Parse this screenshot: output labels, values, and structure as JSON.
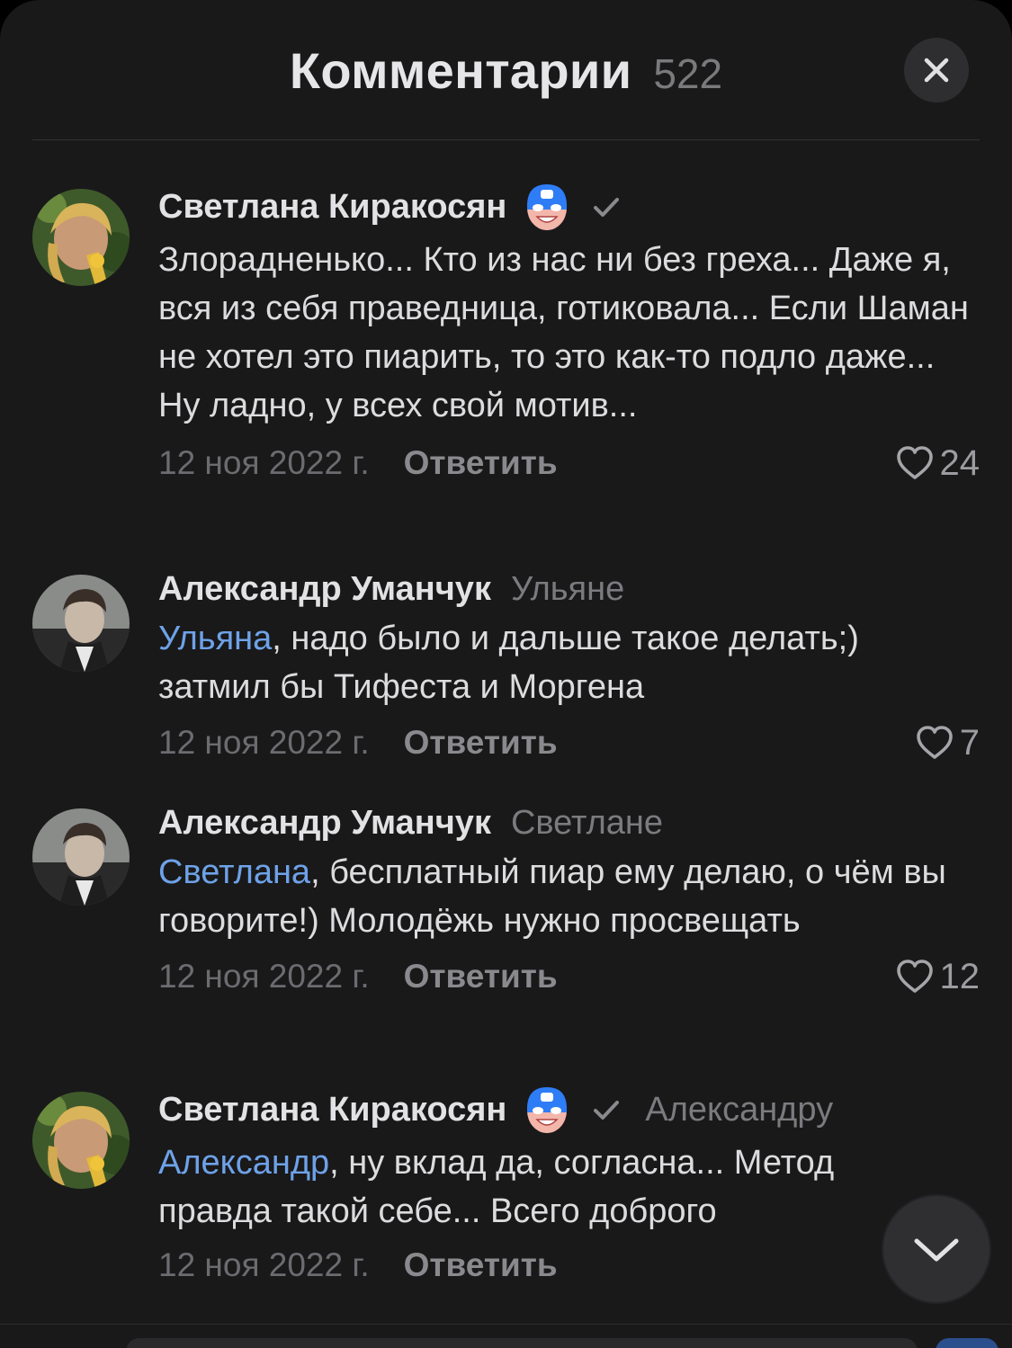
{
  "header": {
    "title": "Комментарии",
    "count": "522"
  },
  "comments": [
    {
      "author": "Светлана Киракосян",
      "reply_to": "",
      "mention": "",
      "text": "Злорадненько... Кто из нас ни без греха... Даже я, вся из себя праведница, готиковала... Если Шаман не хотел это пиарить, то это как-то подло даже... Ну ладно, у всех свой мотив...",
      "date": "12 ноя 2022 г.",
      "reply_label": "Ответить",
      "likes": "24"
    },
    {
      "author": "Александр Уманчук",
      "reply_to": "Ульяне",
      "mention": "Ульяна",
      "text": ", надо было и дальше такое делать;) затмил бы Тифеста и Моргена",
      "date": "12 ноя 2022 г.",
      "reply_label": "Ответить",
      "likes": "7"
    },
    {
      "author": "Александр Уманчук",
      "reply_to": "Светлане",
      "mention": "Светлана",
      "text": ", бесплатный пиар ему делаю, о чём вы говорите!) Молодёжь нужно просвещать",
      "date": "12 ноя 2022 г.",
      "reply_label": "Ответить",
      "likes": "12"
    },
    {
      "author": "Светлана Киракосян",
      "reply_to": "Александру",
      "mention": "Александр",
      "text": ", ну вклад да, согласна... Метод правда такой себе... Всего доброго",
      "date": "12 ноя 2022 г.",
      "reply_label": "Ответить",
      "likes": ""
    }
  ],
  "icons": {
    "close": "close-icon",
    "badge": "superhero-mask-icon",
    "verified": "checkmark-icon",
    "like": "heart-outline-icon",
    "scroll": "chevron-down-icon"
  },
  "colors": {
    "background": "#19191a",
    "mention": "#6ea2e8",
    "badge": "#2f7df6"
  }
}
